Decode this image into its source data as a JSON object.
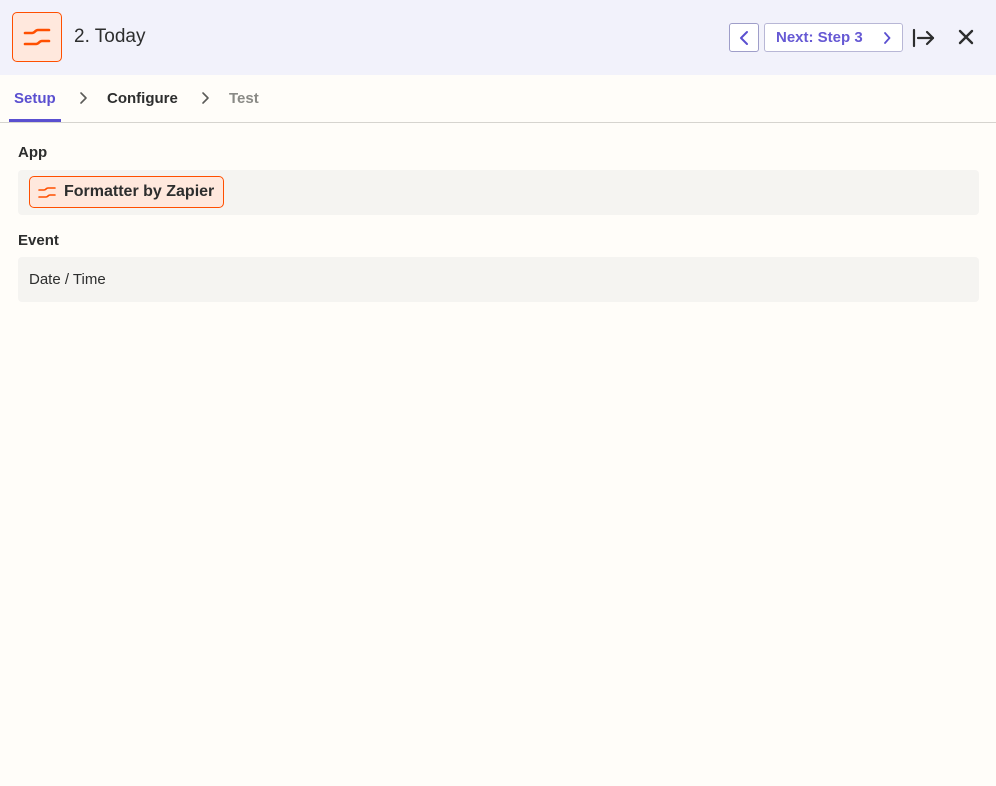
{
  "header": {
    "step_title": "2. Today",
    "next_label": "Next: Step 3",
    "app_icon": "formatter-icon"
  },
  "tabs": [
    {
      "label": "Setup",
      "state": "active"
    },
    {
      "label": "Configure",
      "state": "normal"
    },
    {
      "label": "Test",
      "state": "disabled"
    }
  ],
  "fields": {
    "app": {
      "label": "App",
      "value": "Formatter by Zapier",
      "icon": "formatter-icon"
    },
    "event": {
      "label": "Event",
      "value": "Date / Time"
    }
  },
  "colors": {
    "accent": "#5a4fd0",
    "brand_orange": "#ff4f00",
    "header_bg": "#f2f2fb",
    "page_bg": "#fffdf9"
  }
}
